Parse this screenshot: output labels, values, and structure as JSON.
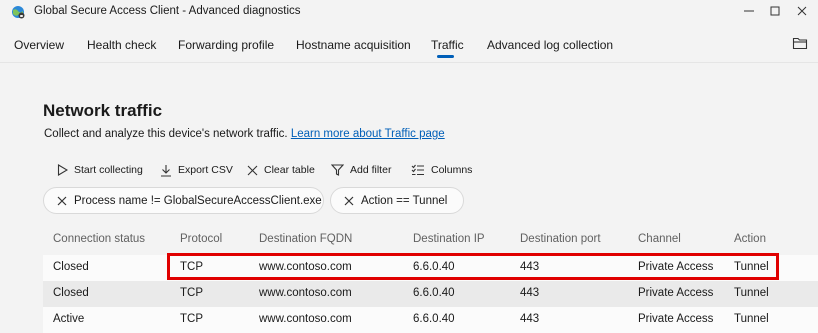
{
  "window": {
    "title": "Global Secure Access Client - Advanced diagnostics"
  },
  "tabs": [
    {
      "label": "Overview"
    },
    {
      "label": "Health check"
    },
    {
      "label": "Forwarding profile"
    },
    {
      "label": "Hostname acquisition"
    },
    {
      "label": "Traffic",
      "selected": true
    },
    {
      "label": "Advanced log collection"
    }
  ],
  "page": {
    "title": "Network traffic",
    "description": "Collect and analyze this device's network traffic.",
    "learn_more": "Learn more about Traffic page"
  },
  "toolbar": {
    "start": "Start collecting",
    "export": "Export CSV",
    "clear": "Clear table",
    "filter": "Add filter",
    "columns": "Columns"
  },
  "filters": [
    {
      "label": "Process name != GlobalSecureAccessClient.exe"
    },
    {
      "label": "Action == Tunnel"
    }
  ],
  "table": {
    "columns": [
      "Connection status",
      "Protocol",
      "Destination FQDN",
      "Destination IP",
      "Destination port",
      "Channel",
      "Action"
    ],
    "rows": [
      [
        "Closed",
        "TCP",
        "www.contoso.com",
        "6.6.0.40",
        "443",
        "Private Access",
        "Tunnel"
      ],
      [
        "Closed",
        "TCP",
        "www.contoso.com",
        "6.6.0.40",
        "443",
        "Private Access",
        "Tunnel"
      ],
      [
        "Active",
        "TCP",
        "www.contoso.com",
        "6.6.0.40",
        "443",
        "Private Access",
        "Tunnel"
      ]
    ]
  },
  "colors": {
    "accent": "#005fb8",
    "highlight": "#e00000"
  }
}
